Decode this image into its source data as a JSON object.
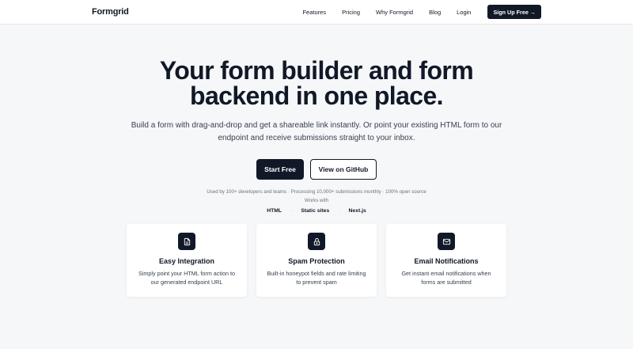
{
  "nav": {
    "brand": "Formgrid",
    "links": [
      "Features",
      "Pricing",
      "Why Formgrid",
      "Blog",
      "Login"
    ],
    "signup": "Sign Up Free →"
  },
  "hero": {
    "headline_line1": "Your form builder and form",
    "headline_line2": "backend in one place.",
    "subtitle": "Build a form with drag-and-drop and get a shareable link instantly. Or point your existing HTML form to our endpoint and receive submissions straight to your inbox.",
    "cta_primary": "Start Free",
    "cta_secondary": "View on GitHub",
    "social_proof": "Used by 100+ developers and teams · Processing 10,000+ submissions monthly · 100% open source",
    "works_with": "Works with",
    "techs": [
      "HTML",
      "Static sites",
      "Next.js"
    ],
    "separator": "·"
  },
  "features": [
    {
      "icon": "document-icon",
      "title": "Easy Integration",
      "desc": "Simply point your HTML form action to our generated endpoint URL"
    },
    {
      "icon": "lock-icon",
      "title": "Spam Protection",
      "desc": "Built-in honeypot fields and rate limiting to prevent spam"
    },
    {
      "icon": "mail-icon",
      "title": "Email Notifications",
      "desc": "Get instant email notifications when forms are submitted"
    }
  ],
  "colors": {
    "primary": "#111827",
    "background": "#f6f7f8",
    "card": "#ffffff"
  }
}
